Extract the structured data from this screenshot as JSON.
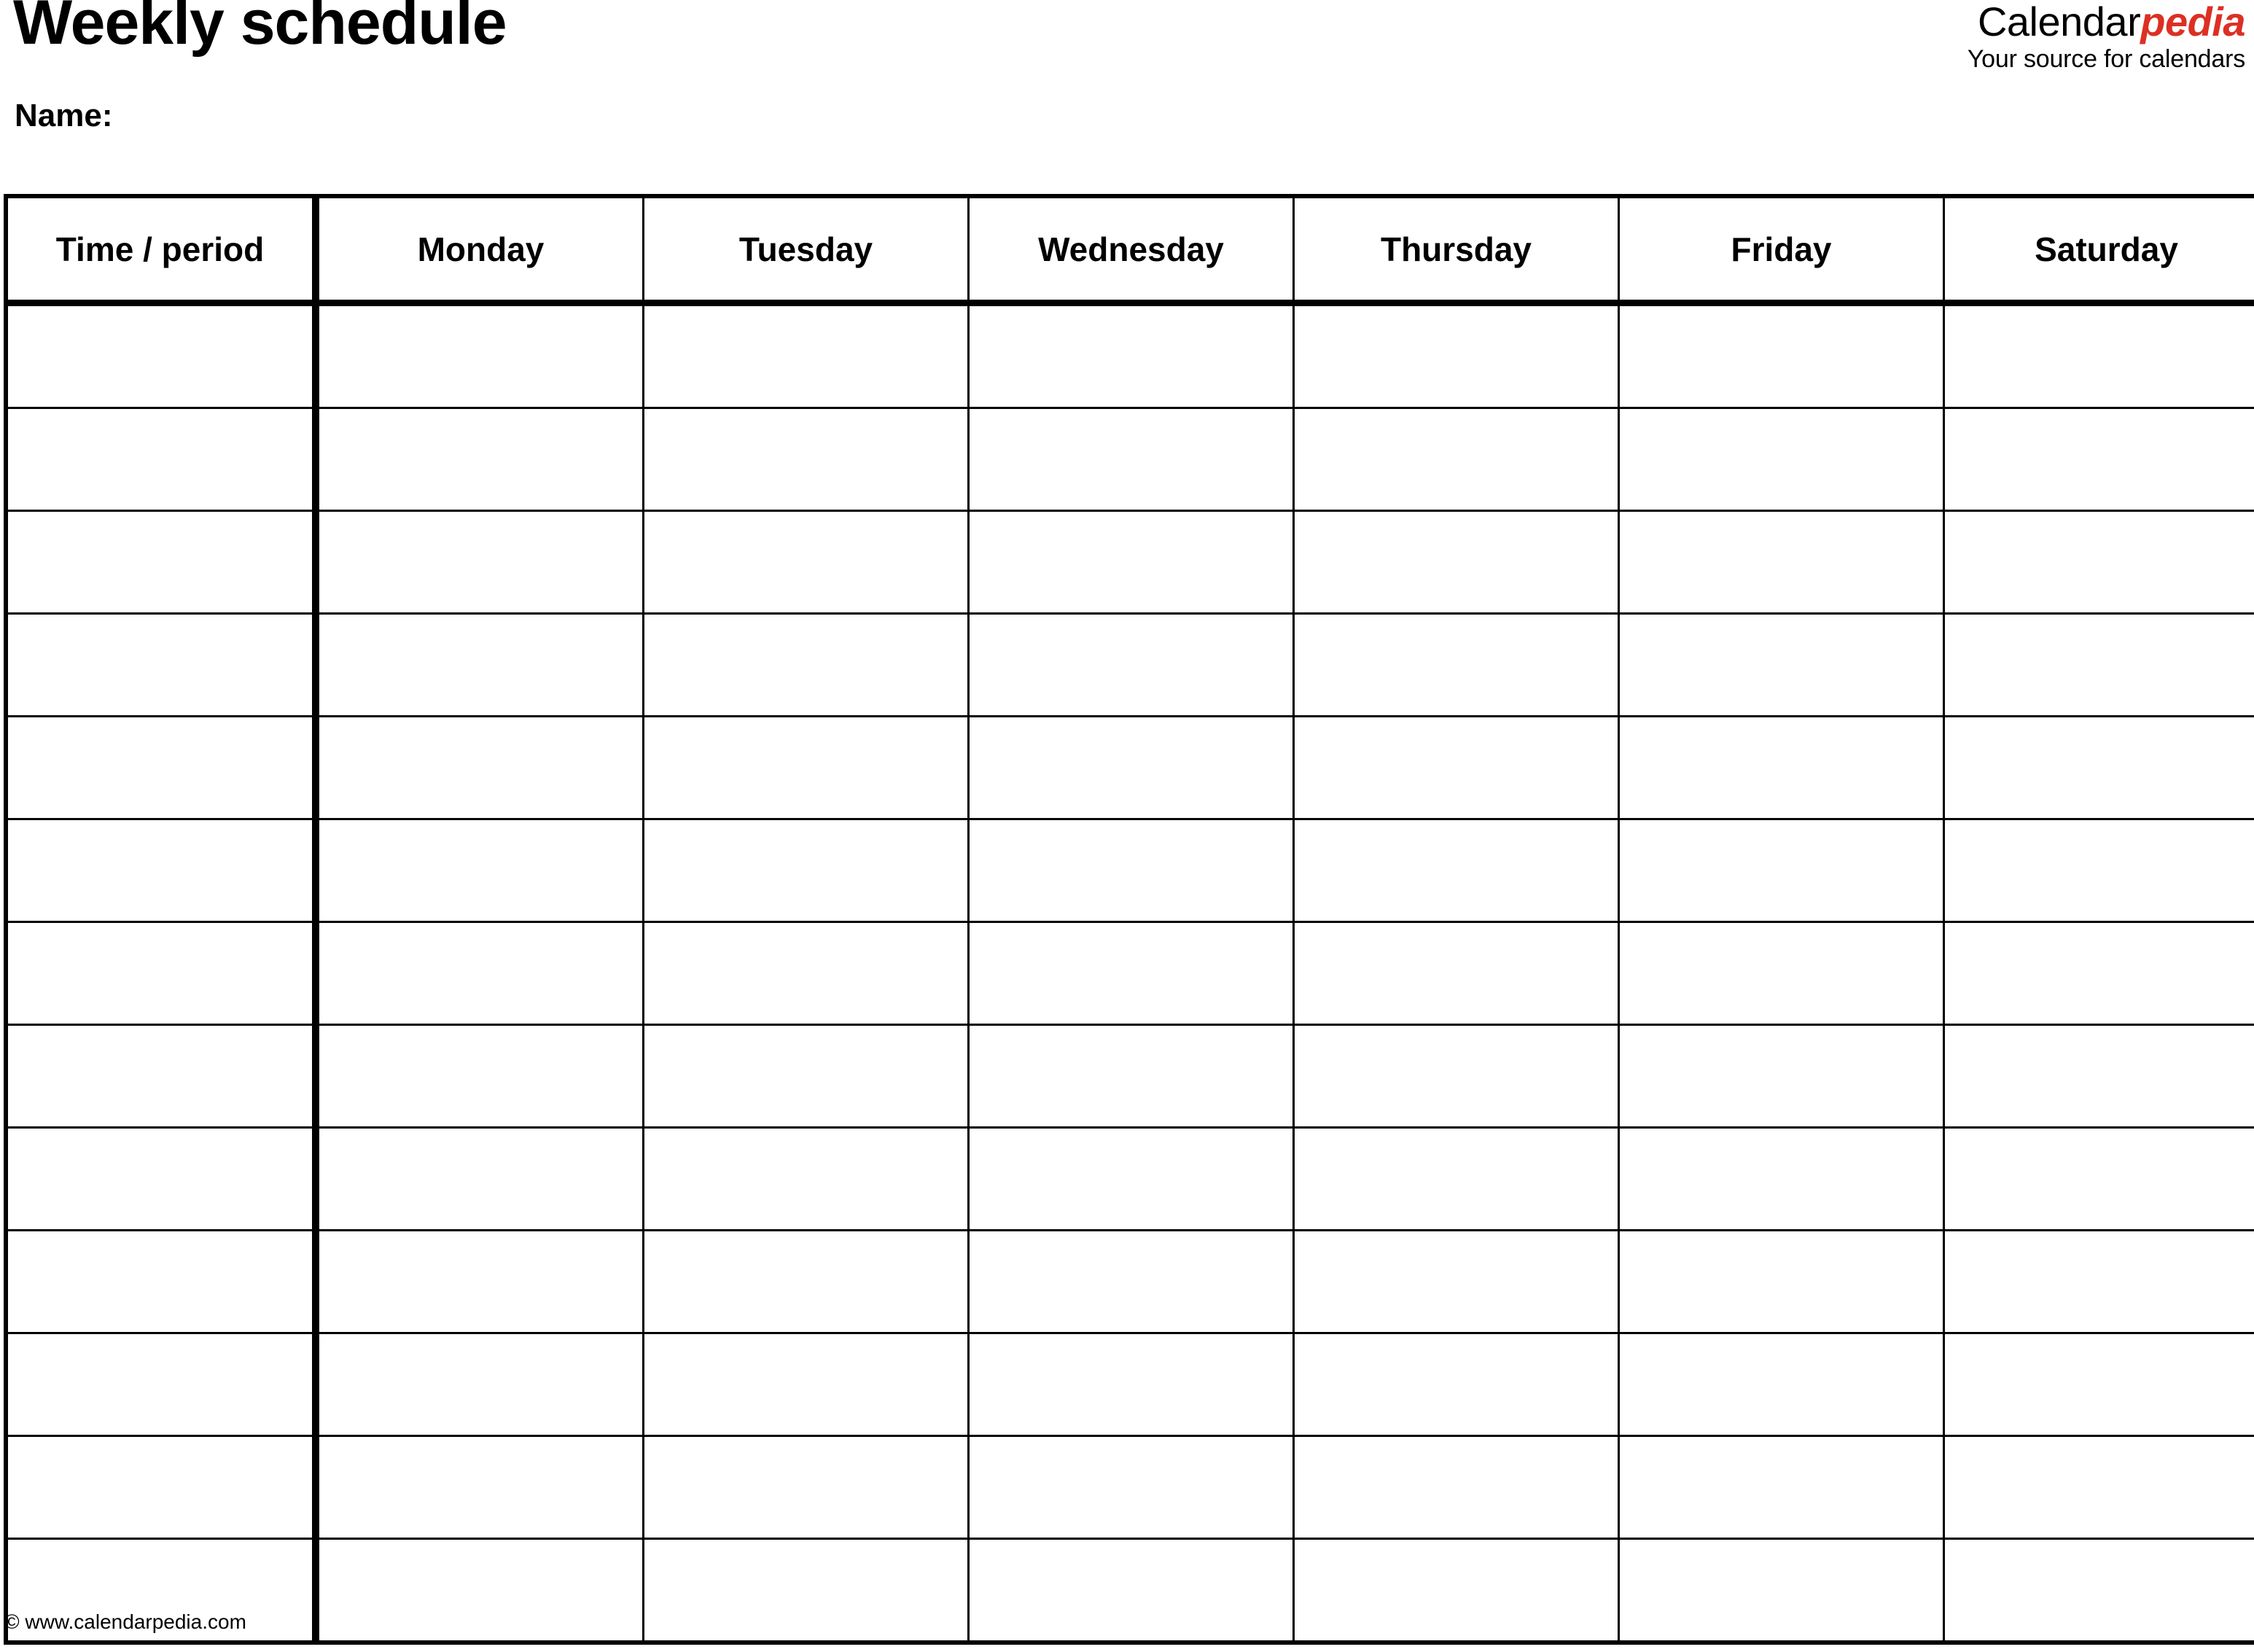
{
  "header": {
    "title": "Weekly schedule",
    "name_label": "Name:"
  },
  "brand": {
    "word_primary": "Calendar",
    "word_accent": "pedia",
    "tagline": "Your source for calendars",
    "accent_color": "#DC3023",
    "primary_color": "#000000"
  },
  "table": {
    "columns": [
      "Time / period",
      "Monday",
      "Tuesday",
      "Wednesday",
      "Thursday",
      "Friday",
      "Saturday"
    ],
    "row_count": 13,
    "rows": [
      [
        "",
        "",
        "",
        "",
        "",
        "",
        ""
      ],
      [
        "",
        "",
        "",
        "",
        "",
        "",
        ""
      ],
      [
        "",
        "",
        "",
        "",
        "",
        "",
        ""
      ],
      [
        "",
        "",
        "",
        "",
        "",
        "",
        ""
      ],
      [
        "",
        "",
        "",
        "",
        "",
        "",
        ""
      ],
      [
        "",
        "",
        "",
        "",
        "",
        "",
        ""
      ],
      [
        "",
        "",
        "",
        "",
        "",
        "",
        ""
      ],
      [
        "",
        "",
        "",
        "",
        "",
        "",
        ""
      ],
      [
        "",
        "",
        "",
        "",
        "",
        "",
        ""
      ],
      [
        "",
        "",
        "",
        "",
        "",
        "",
        ""
      ],
      [
        "",
        "",
        "",
        "",
        "",
        "",
        ""
      ],
      [
        "",
        "",
        "",
        "",
        "",
        "",
        ""
      ],
      [
        "",
        "",
        "",
        "",
        "",
        "",
        ""
      ]
    ]
  },
  "footer": {
    "copyright": "© www.calendarpedia.com"
  }
}
